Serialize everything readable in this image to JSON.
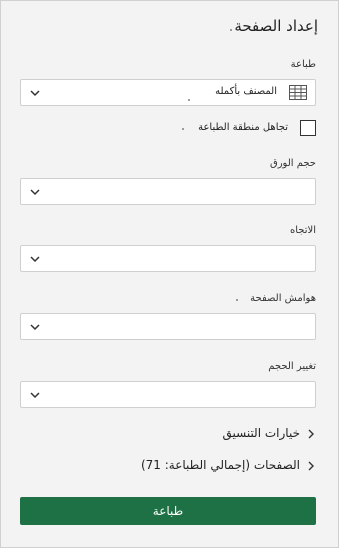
{
  "panel": {
    "title": "إعداد الصفحة"
  },
  "print_section": {
    "label": "طباعة",
    "selected": "المصنف بأكمله",
    "icon": "table-grid-icon"
  },
  "ignore_print_area": {
    "label": "تجاهل منطقة الطباعة",
    "checked": false
  },
  "paper_size": {
    "label": "حجم الورق",
    "selected": ""
  },
  "orientation": {
    "label": "الاتجاه",
    "selected": ""
  },
  "margins": {
    "label": "هوامش الصفحة",
    "selected": ""
  },
  "scaling": {
    "label": "تغيير الحجم",
    "selected": ""
  },
  "formatting_options": {
    "label": "خيارات التنسيق"
  },
  "pages": {
    "label": "الصفحات (إجمالي الطباعة: 71)"
  },
  "print_button": {
    "label": "طباعة",
    "color": "#1e7145"
  }
}
